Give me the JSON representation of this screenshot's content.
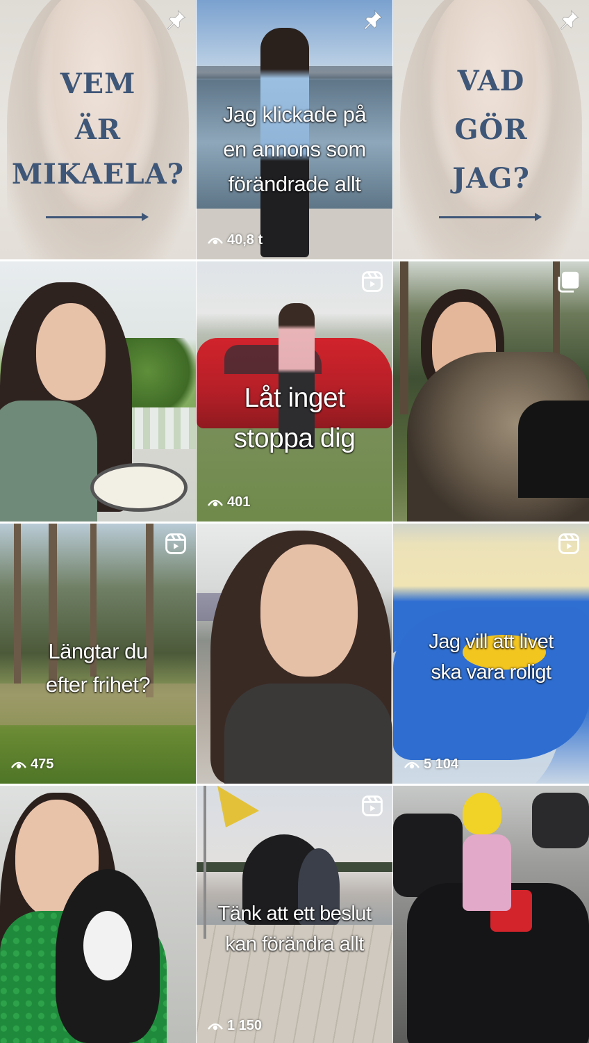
{
  "tiles": [
    {
      "id": "vem",
      "type": "text-card",
      "lines": [
        "VEM",
        "ÄR",
        "MIKAELA?"
      ],
      "icon": "pin-icon"
    },
    {
      "id": "annons",
      "type": "reel",
      "caption": [
        "Jag klickade på",
        "en annons som",
        "förändrade allt"
      ],
      "views": "40,8 t",
      "icon": "pin-icon"
    },
    {
      "id": "vad",
      "type": "text-card",
      "lines": [
        "VAD",
        "GÖR",
        "JAG?"
      ],
      "icon": "pin-icon"
    },
    {
      "id": "selfie-porch",
      "type": "photo"
    },
    {
      "id": "stoppa",
      "type": "reel",
      "caption": [
        "Låt inget",
        "stoppa dig"
      ],
      "views": "401",
      "icon": "reel-icon"
    },
    {
      "id": "cat-forest",
      "type": "photo",
      "icon": "carousel-icon"
    },
    {
      "id": "frihet",
      "type": "reel",
      "caption": [
        "Längtar du",
        "efter frihet?"
      ],
      "views": "475",
      "icon": "reel-icon"
    },
    {
      "id": "selfie-station",
      "type": "photo"
    },
    {
      "id": "roligt",
      "type": "reel",
      "caption": [
        "Jag vill att livet",
        "ska vara roligt"
      ],
      "views": "5 104",
      "icon": "reel-icon"
    },
    {
      "id": "cat-sofa",
      "type": "photo"
    },
    {
      "id": "beslut",
      "type": "reel",
      "caption": [
        "Tänk att ett beslut",
        "kan förändra allt"
      ],
      "views": "1 150",
      "icon": "reel-icon"
    },
    {
      "id": "karting",
      "type": "photo"
    }
  ],
  "colors": {
    "card_text": "#3e5677",
    "overlay_text": "#ffffff"
  }
}
